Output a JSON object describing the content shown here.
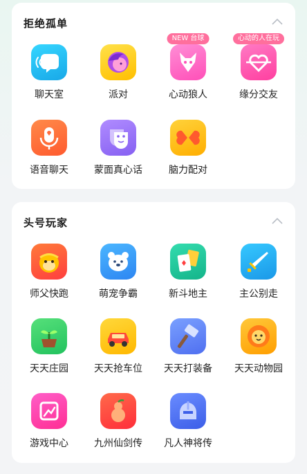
{
  "sections": [
    {
      "title": "拒绝孤单",
      "apps": [
        {
          "label": "聊天室",
          "icon": "voice-chat-icon",
          "color": "#22c4f0"
        },
        {
          "label": "派对",
          "icon": "party-avatar-icon",
          "color": "#ffcc00"
        },
        {
          "label": "心动狼人",
          "icon": "wolf-icon",
          "color": "#ff6fc8",
          "badge": "NEW 台球"
        },
        {
          "label": "缘分交友",
          "icon": "heart-icon",
          "color": "#ff4fa4",
          "badge": "心动的人在玩"
        },
        {
          "label": "语音聊天",
          "icon": "microphone-icon",
          "color": "#ff6a3d"
        },
        {
          "label": "蒙面真心话",
          "icon": "mask-icon",
          "color": "#9a72ff"
        },
        {
          "label": "脑力配对",
          "icon": "butterfly-hearts-icon",
          "color": "#ffb800"
        }
      ]
    },
    {
      "title": "头号玩家",
      "apps": [
        {
          "label": "师父快跑",
          "icon": "monkey-icon",
          "color": "#ff5b3a"
        },
        {
          "label": "萌宠争霸",
          "icon": "bear-icon",
          "color": "#3aa0ff"
        },
        {
          "label": "新斗地主",
          "icon": "playing-cards-icon",
          "color": "#20c9a0"
        },
        {
          "label": "主公别走",
          "icon": "sword-icon",
          "color": "#2bb8f2"
        },
        {
          "label": "天天庄园",
          "icon": "sprout-icon",
          "color": "#2bd36a"
        },
        {
          "label": "天天抢车位",
          "icon": "car-icon",
          "color": "#ffc800"
        },
        {
          "label": "天天打装备",
          "icon": "hammer-icon",
          "color": "#6a8dff"
        },
        {
          "label": "天天动物园",
          "icon": "lion-icon",
          "color": "#ffb000"
        },
        {
          "label": "游戏中心",
          "icon": "game-center-icon",
          "color": "#ff3fa8"
        },
        {
          "label": "九州仙剑传",
          "icon": "gourd-icon",
          "color": "#ff4b3a"
        },
        {
          "label": "凡人神将传",
          "icon": "warrior-helmet-icon",
          "color": "#4b78ff"
        }
      ]
    }
  ]
}
